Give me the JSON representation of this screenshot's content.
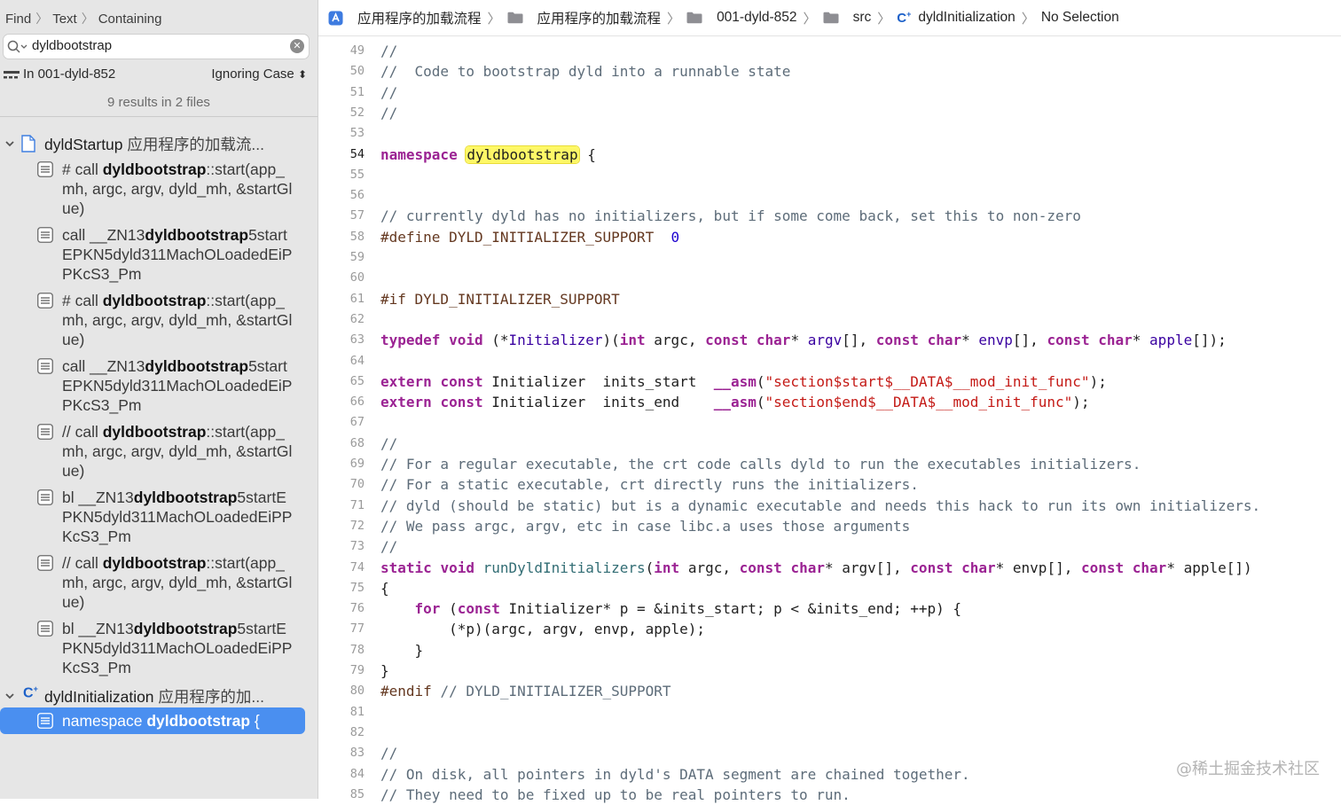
{
  "navigator": {
    "breadcrumb": [
      "Find",
      "Text",
      "Containing"
    ],
    "search_query": "dyldbootstrap",
    "scope_label": "In 001-dyld-852",
    "case_option": "Ignoring Case",
    "results_summary": "9 results in 2 files",
    "files": [
      {
        "name": "dyldStartup",
        "path": "应用程序的加载流...",
        "icon": "asm-file-icon"
      },
      {
        "name": "dyldInitialization",
        "path": "应用程序的加...",
        "icon": "cpp-file-icon"
      }
    ],
    "matches": [
      {
        "pre": "# call ",
        "hit": "dyldbootstrap",
        "post": "::start(app_mh, argc, argv, dyld_mh, &startGlue)"
      },
      {
        "pre": "call __ZN13",
        "hit": "dyldbootstrap",
        "post": "5startEPKN5dyld311MachOLoadedEiPPKcS3_Pm"
      },
      {
        "pre": "# call ",
        "hit": "dyldbootstrap",
        "post": "::start(app_mh, argc, argv, dyld_mh, &startGlue)"
      },
      {
        "pre": "call __ZN13",
        "hit": "dyldbootstrap",
        "post": "5startEPKN5dyld311MachOLoadedEiPPKcS3_Pm"
      },
      {
        "pre": "// call ",
        "hit": "dyldbootstrap",
        "post": "::start(app_mh, argc, argv, dyld_mh, &startGlue)"
      },
      {
        "pre": "bl __ZN13",
        "hit": "dyldbootstrap",
        "post": "5startEPKN5dyld311MachOLoadedEiPPKcS3_Pm"
      },
      {
        "pre": "// call ",
        "hit": "dyldbootstrap",
        "post": "::start(app_mh, argc, argv, dyld_mh, &startGlue)"
      },
      {
        "pre": "bl __ZN13",
        "hit": "dyldbootstrap",
        "post": "5startEPKN5dyld311MachOLoadedEiPPKcS3_Pm"
      },
      {
        "pre": "namespace ",
        "hit": "dyldbootstrap",
        "post": " {"
      }
    ],
    "selected_match_index": 8
  },
  "editor": {
    "jump_bar": [
      {
        "label": "应用程序的加载流程",
        "icon": "project-icon"
      },
      {
        "label": "应用程序的加载流程",
        "icon": "folder-icon"
      },
      {
        "label": "001-dyld-852",
        "icon": "folder-icon"
      },
      {
        "label": "src",
        "icon": "folder-icon"
      },
      {
        "label": "dyldInitialization",
        "icon": "cpp-file-icon"
      },
      {
        "label": "No Selection",
        "icon": ""
      }
    ],
    "current_line": 54,
    "code_lines": [
      {
        "n": 49,
        "text": "//"
      },
      {
        "n": 50,
        "text": "//  Code to bootstrap dyld into a runnable state"
      },
      {
        "n": 51,
        "text": "//"
      },
      {
        "n": 52,
        "text": "//"
      },
      {
        "n": 53,
        "text": ""
      },
      {
        "n": 54,
        "text": "namespace dyldbootstrap {"
      },
      {
        "n": 55,
        "text": ""
      },
      {
        "n": 56,
        "text": ""
      },
      {
        "n": 57,
        "text": "// currently dyld has no initializers, but if some come back, set this to non-zero"
      },
      {
        "n": 58,
        "text": "#define DYLD_INITIALIZER_SUPPORT  0"
      },
      {
        "n": 59,
        "text": ""
      },
      {
        "n": 60,
        "text": ""
      },
      {
        "n": 61,
        "text": "#if DYLD_INITIALIZER_SUPPORT"
      },
      {
        "n": 62,
        "text": ""
      },
      {
        "n": 63,
        "text": "typedef void (*Initializer)(int argc, const char* argv[], const char* envp[], const char* apple[]);"
      },
      {
        "n": 64,
        "text": ""
      },
      {
        "n": 65,
        "text": "extern const Initializer  inits_start  __asm(\"section$start$__DATA$__mod_init_func\");"
      },
      {
        "n": 66,
        "text": "extern const Initializer  inits_end    __asm(\"section$end$__DATA$__mod_init_func\");"
      },
      {
        "n": 67,
        "text": ""
      },
      {
        "n": 68,
        "text": "//"
      },
      {
        "n": 69,
        "text": "// For a regular executable, the crt code calls dyld to run the executables initializers."
      },
      {
        "n": 70,
        "text": "// For a static executable, crt directly runs the initializers."
      },
      {
        "n": 71,
        "text": "// dyld (should be static) but is a dynamic executable and needs this hack to run its own initializers."
      },
      {
        "n": 72,
        "text": "// We pass argc, argv, etc in case libc.a uses those arguments"
      },
      {
        "n": 73,
        "text": "//"
      },
      {
        "n": 74,
        "text": "static void runDyldInitializers(int argc, const char* argv[], const char* envp[], const char* apple[])"
      },
      {
        "n": 75,
        "text": "{"
      },
      {
        "n": 76,
        "text": "    for (const Initializer* p = &inits_start; p < &inits_end; ++p) {"
      },
      {
        "n": 77,
        "text": "        (*p)(argc, argv, envp, apple);"
      },
      {
        "n": 78,
        "text": "    }"
      },
      {
        "n": 79,
        "text": "}"
      },
      {
        "n": 80,
        "text": "#endif // DYLD_INITIALIZER_SUPPORT"
      },
      {
        "n": 81,
        "text": ""
      },
      {
        "n": 82,
        "text": ""
      },
      {
        "n": 83,
        "text": "//"
      },
      {
        "n": 84,
        "text": "// On disk, all pointers in dyld's DATA segment are chained together."
      },
      {
        "n": 85,
        "text": "// They need to be fixed up to be real pointers to run."
      }
    ]
  },
  "watermark": "@稀土掘金技术社区",
  "colors": {
    "keyword": "#9b2393",
    "comment": "#5d6c79",
    "string": "#c41a16",
    "number": "#1c00cf",
    "selection": "#4a8ff0",
    "find_highlight": "#fef867"
  }
}
